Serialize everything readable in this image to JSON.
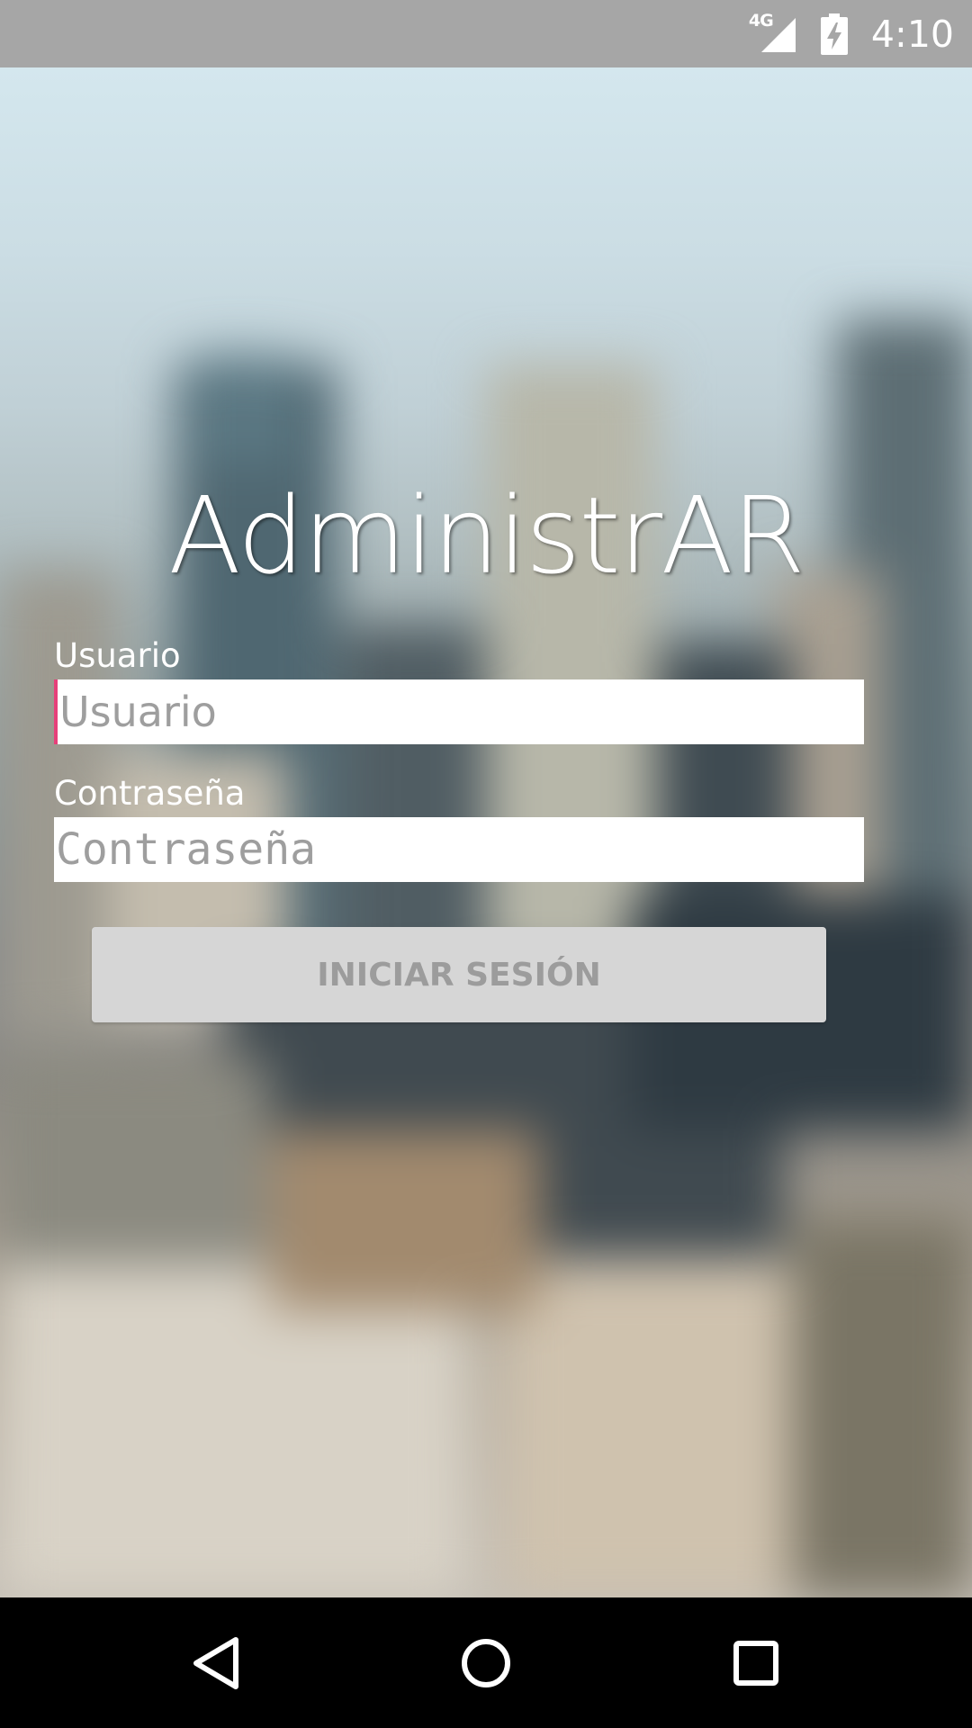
{
  "status_bar": {
    "network_label": "4G",
    "time": "4:10",
    "icons": [
      "signal-icon",
      "battery-charging-icon"
    ]
  },
  "app": {
    "title": "AdministrAR"
  },
  "form": {
    "username": {
      "label": "Usuario",
      "placeholder": "Usuario",
      "value": ""
    },
    "password": {
      "label": "Contraseña",
      "placeholder": "Contraseña",
      "value": ""
    },
    "login_button_label": "INICIAR SESIÓN"
  },
  "nav_bar": {
    "icons": [
      "back-icon",
      "home-icon",
      "recents-icon"
    ]
  },
  "colors": {
    "status_bar_bg": "#a6a6a6",
    "input_cursor_accent": "#e6407a",
    "button_bg": "#d6d6d6",
    "button_text": "#9c9c9c",
    "nav_bar_bg": "#000000"
  }
}
